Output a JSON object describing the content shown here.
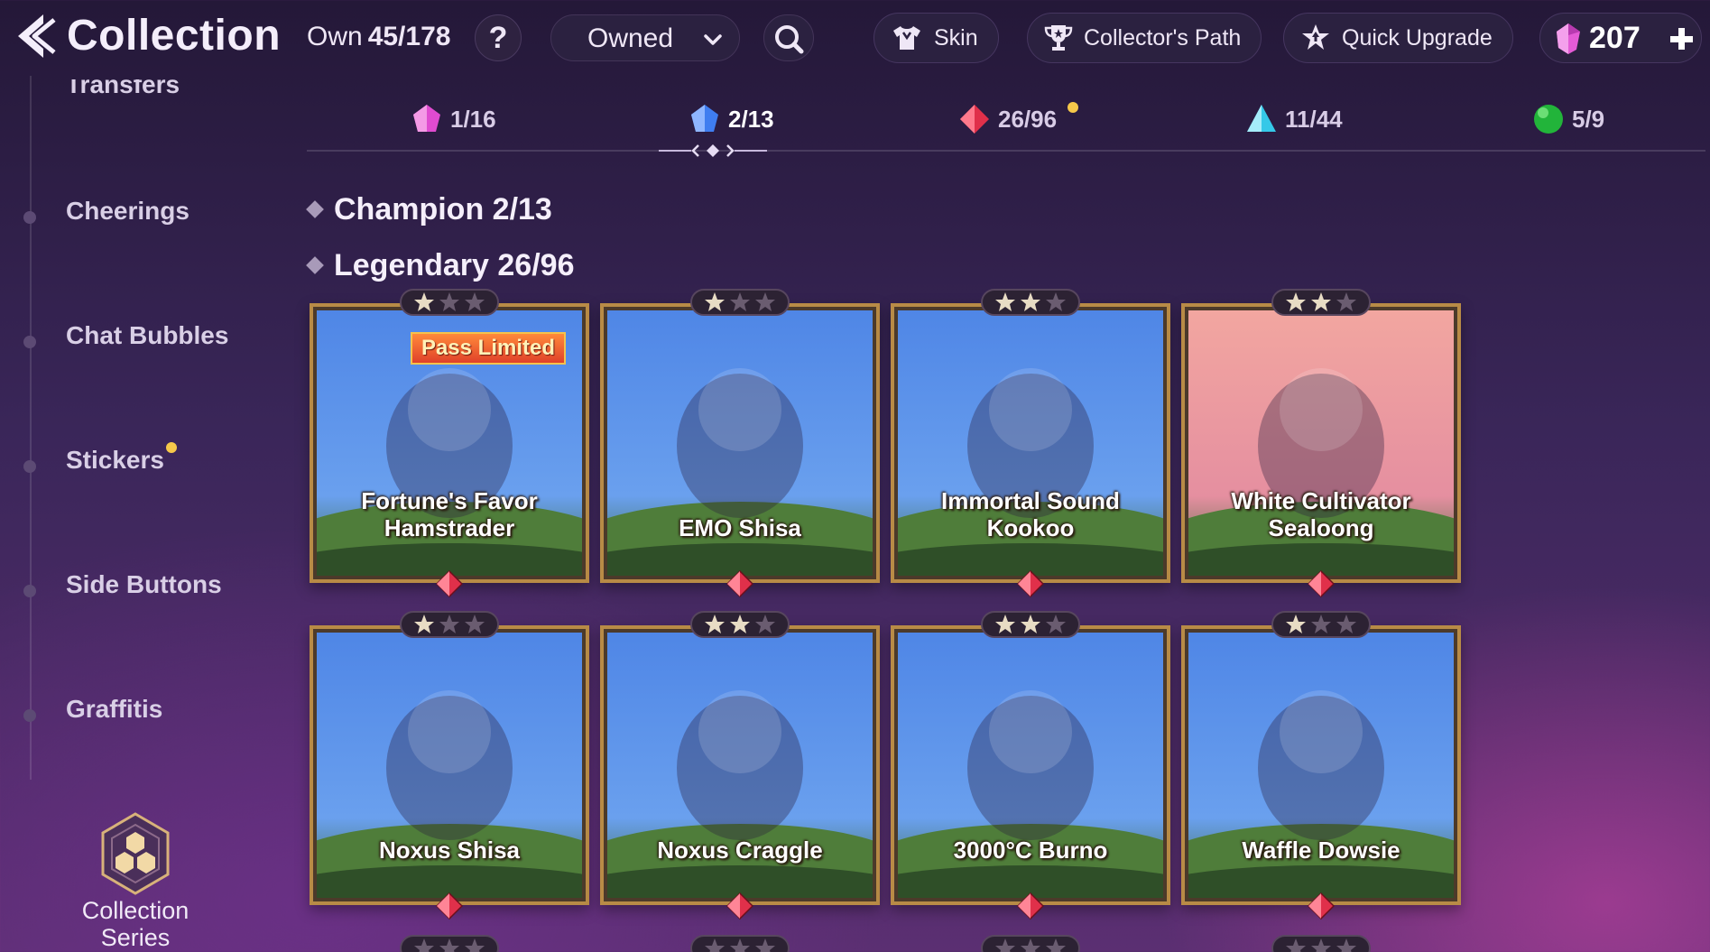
{
  "header": {
    "title": "Collection",
    "own_label": "Own",
    "own_value": "45/178",
    "help_symbol": "?",
    "filter_selected": "Owned",
    "skin_label": "Skin",
    "collectors_path_label": "Collector's Path",
    "quick_upgrade_label": "Quick Upgrade",
    "currency_amount": "207"
  },
  "sidebar": {
    "partial_item": "Transfers",
    "items": [
      {
        "label": "Cheerings",
        "badge": false
      },
      {
        "label": "Chat Bubbles",
        "badge": false
      },
      {
        "label": "Stickers",
        "badge": true
      },
      {
        "label": "Side Buttons",
        "badge": false
      },
      {
        "label": "Graffitis",
        "badge": false
      }
    ],
    "series_label": "Collection Series"
  },
  "rarity_tabs": [
    {
      "count": "1/16",
      "gem": "pink",
      "color": "#e04bd0"
    },
    {
      "count": "2/13",
      "gem": "blue",
      "color": "#3f7df0",
      "active": true
    },
    {
      "count": "26/96",
      "gem": "red",
      "color": "#e0304a",
      "badge": true
    },
    {
      "count": "11/44",
      "gem": "cyan",
      "color": "#35c8e8"
    },
    {
      "count": "5/9",
      "gem": "green",
      "color": "#22b43a"
    }
  ],
  "sections": {
    "champion": "Champion 2/13",
    "legendary": "Legendary 26/96"
  },
  "cards": [
    {
      "name_line1": "Fortune's Favor",
      "name_line2": "Hamstrader",
      "stars": 1,
      "ribbon": "Pass Limited",
      "bg": "sky"
    },
    {
      "name_line1": "",
      "name_line2": "EMO Shisa",
      "stars": 1,
      "ribbon": "",
      "bg": "sky"
    },
    {
      "name_line1": "Immortal Sound",
      "name_line2": "Kookoo",
      "stars": 2,
      "ribbon": "",
      "bg": "sky"
    },
    {
      "name_line1": "White Cultivator",
      "name_line2": "Sealoong",
      "stars": 2,
      "ribbon": "",
      "bg": "sunset"
    },
    {
      "name_line1": "",
      "name_line2": "Noxus Shisa",
      "stars": 1,
      "ribbon": "",
      "bg": "sky"
    },
    {
      "name_line1": "",
      "name_line2": "Noxus Craggle",
      "stars": 2,
      "ribbon": "",
      "bg": "sky"
    },
    {
      "name_line1": "",
      "name_line2": "3000°C Burno",
      "stars": 2,
      "ribbon": "",
      "bg": "sky"
    },
    {
      "name_line1": "",
      "name_line2": "Waffle Dowsie",
      "stars": 1,
      "ribbon": "",
      "bg": "sky"
    }
  ],
  "colors": {
    "card_border": "#b88b46",
    "legendary_gem": "#e0304a",
    "badge": "#f6c84a"
  },
  "icons": {
    "back": "back-arrow-icon",
    "help": "question-icon",
    "dropdown": "chevron-down-icon",
    "search": "search-icon",
    "skin": "shirt-icon",
    "collectors_path": "trophy-icon",
    "quick_upgrade": "star-upgrade-icon",
    "currency": "pink-gem-icon",
    "add": "plus-icon",
    "series": "hexagon-series-icon"
  }
}
